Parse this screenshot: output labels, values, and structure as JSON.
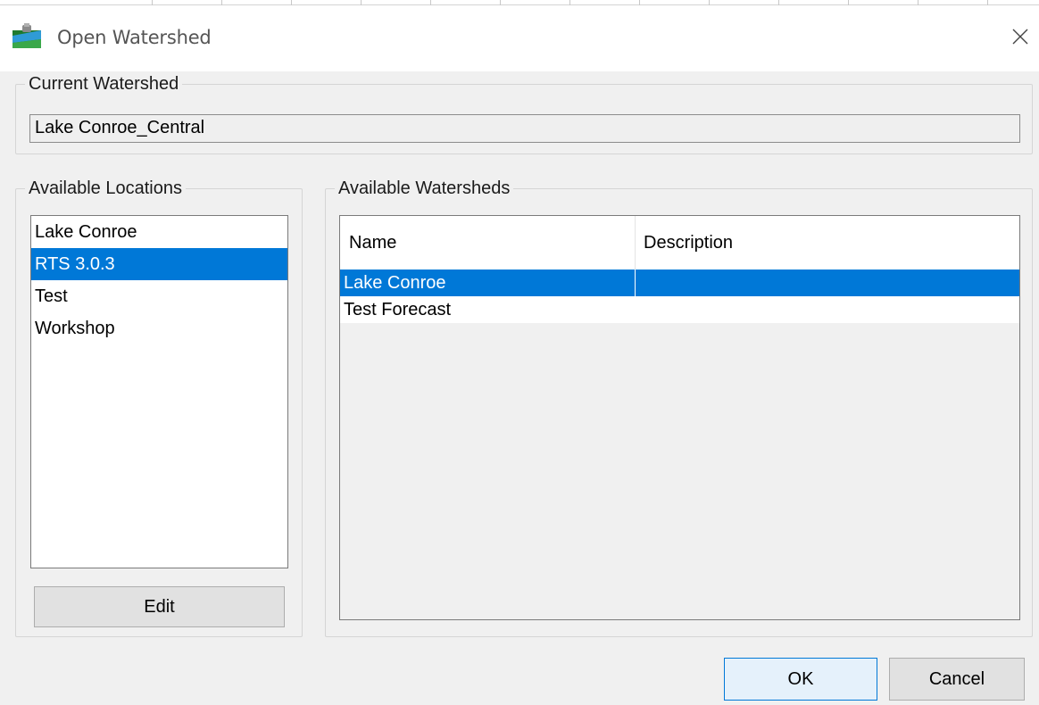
{
  "window": {
    "title": "Open Watershed",
    "app_icon": "watershed-app-icon",
    "close_icon": "close-icon"
  },
  "current_watershed": {
    "legend": "Current Watershed",
    "value": "Lake Conroe_Central"
  },
  "locations": {
    "legend": "Available Locations",
    "items": [
      "Lake Conroe",
      "RTS 3.0.3",
      "Test",
      "Workshop"
    ],
    "selected_index": 1,
    "edit_label": "Edit"
  },
  "watersheds": {
    "legend": "Available Watersheds",
    "columns": [
      "Name",
      "Description"
    ],
    "rows": [
      {
        "name": "Lake Conroe",
        "description": ""
      },
      {
        "name": "Test Forecast",
        "description": ""
      }
    ],
    "selected_index": 0
  },
  "buttons": {
    "ok": "OK",
    "cancel": "Cancel"
  },
  "colors": {
    "selection": "#0078d7",
    "background": "#f0f0f0"
  }
}
